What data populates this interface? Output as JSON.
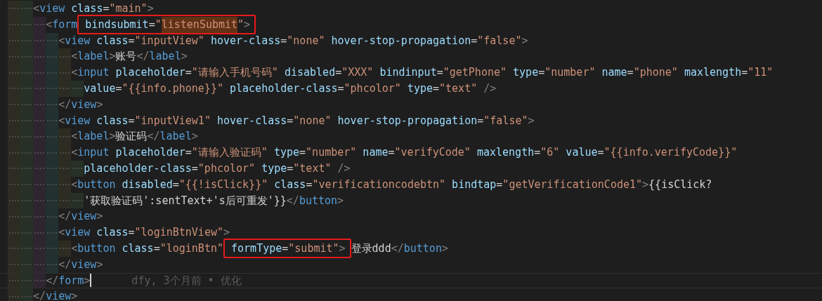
{
  "editor": {
    "lines": [
      {
        "current": false,
        "tokens": [
          {
            "kind": "punct",
            "text": "<"
          },
          {
            "kind": "tag",
            "text": "view"
          },
          {
            "kind": "attr",
            "text": "class"
          },
          {
            "kind": "eq",
            "text": "="
          },
          {
            "kind": "string",
            "text": "\"main\""
          },
          {
            "kind": "punct",
            "text": ">"
          }
        ],
        "children": [
          {
            "current": false,
            "tokens": [
              {
                "kind": "punct",
                "text": "<"
              },
              {
                "kind": "tag",
                "text": "form"
              },
              {
                "kind": "box",
                "tokens": [
                  {
                    "kind": "attr",
                    "text": "bindsubmit"
                  },
                  {
                    "kind": "eq",
                    "text": "="
                  },
                  {
                    "kind": "string",
                    "text": "\""
                  },
                  {
                    "kind": "match",
                    "text": "listenSubmit"
                  },
                  {
                    "kind": "string",
                    "text": "\""
                  },
                  {
                    "kind": "punct",
                    "text": ">"
                  }
                ]
              }
            ],
            "children": [
              {
                "current": false,
                "tokens": [
                  {
                    "kind": "punct",
                    "text": "<"
                  },
                  {
                    "kind": "tag",
                    "text": "view"
                  },
                  {
                    "kind": "attr",
                    "text": "class"
                  },
                  {
                    "kind": "eq",
                    "text": "="
                  },
                  {
                    "kind": "string",
                    "text": "\"inputView\""
                  },
                  {
                    "kind": "attr",
                    "text": "hover-class"
                  },
                  {
                    "kind": "eq",
                    "text": "="
                  },
                  {
                    "kind": "string",
                    "text": "\"none\""
                  },
                  {
                    "kind": "attr",
                    "text": "hover-stop-propagation"
                  },
                  {
                    "kind": "eq",
                    "text": "="
                  },
                  {
                    "kind": "string",
                    "text": "\"false\""
                  },
                  {
                    "kind": "punct",
                    "text": ">"
                  }
                ],
                "children": [
                  {
                    "current": false,
                    "tokens": [
                      {
                        "kind": "punct",
                        "text": "<"
                      },
                      {
                        "kind": "tag",
                        "text": "label"
                      },
                      {
                        "kind": "punct",
                        "text": ">"
                      },
                      {
                        "kind": "text",
                        "text": "账号"
                      },
                      {
                        "kind": "punct",
                        "text": "</"
                      },
                      {
                        "kind": "tag",
                        "text": "label"
                      },
                      {
                        "kind": "punct",
                        "text": ">"
                      }
                    ]
                  },
                  {
                    "current": false,
                    "tokens": [
                      {
                        "kind": "punct",
                        "text": "<"
                      },
                      {
                        "kind": "tag",
                        "text": "input"
                      },
                      {
                        "kind": "attr",
                        "text": "placeholder"
                      },
                      {
                        "kind": "eq",
                        "text": "="
                      },
                      {
                        "kind": "string",
                        "text": "\"请输入手机号码\""
                      },
                      {
                        "kind": "attr",
                        "text": "disabled"
                      },
                      {
                        "kind": "eq",
                        "text": "="
                      },
                      {
                        "kind": "string",
                        "text": "\"XXX\""
                      },
                      {
                        "kind": "attr",
                        "text": "bindinput"
                      },
                      {
                        "kind": "eq",
                        "text": "="
                      },
                      {
                        "kind": "string",
                        "text": "\"getPhone\""
                      },
                      {
                        "kind": "attr",
                        "text": "type"
                      },
                      {
                        "kind": "eq",
                        "text": "="
                      },
                      {
                        "kind": "string",
                        "text": "\"number\""
                      },
                      {
                        "kind": "attr",
                        "text": "name"
                      },
                      {
                        "kind": "eq",
                        "text": "="
                      },
                      {
                        "kind": "string",
                        "text": "\"phone\""
                      },
                      {
                        "kind": "attr",
                        "text": "maxlength"
                      },
                      {
                        "kind": "eq",
                        "text": "="
                      },
                      {
                        "kind": "string",
                        "text": "\"11\""
                      }
                    ],
                    "continuation": [
                      {
                        "tokens": [
                          {
                            "kind": "attr",
                            "text": "value"
                          },
                          {
                            "kind": "eq",
                            "text": "="
                          },
                          {
                            "kind": "string",
                            "text": "\"{{info.phone}}\""
                          },
                          {
                            "kind": "attr",
                            "text": "placeholder-class"
                          },
                          {
                            "kind": "eq",
                            "text": "="
                          },
                          {
                            "kind": "string",
                            "text": "\"phcolor\""
                          },
                          {
                            "kind": "attr",
                            "text": "type"
                          },
                          {
                            "kind": "eq",
                            "text": "="
                          },
                          {
                            "kind": "string",
                            "text": "\"text\""
                          },
                          {
                            "kind": "selfclose",
                            "text": "/>"
                          }
                        ]
                      }
                    ]
                  }
                ]
              },
              {
                "current": false,
                "tokens": [
                  {
                    "kind": "punct",
                    "text": "</"
                  },
                  {
                    "kind": "tag",
                    "text": "view"
                  },
                  {
                    "kind": "punct",
                    "text": ">"
                  }
                ]
              },
              {
                "current": false,
                "tokens": [
                  {
                    "kind": "punct",
                    "text": "<"
                  },
                  {
                    "kind": "tag",
                    "text": "view"
                  },
                  {
                    "kind": "attr",
                    "text": "class"
                  },
                  {
                    "kind": "eq",
                    "text": "="
                  },
                  {
                    "kind": "string",
                    "text": "\"inputView1\""
                  },
                  {
                    "kind": "attr",
                    "text": "hover-class"
                  },
                  {
                    "kind": "eq",
                    "text": "="
                  },
                  {
                    "kind": "string",
                    "text": "\"none\""
                  },
                  {
                    "kind": "attr",
                    "text": "hover-stop-propagation"
                  },
                  {
                    "kind": "eq",
                    "text": "="
                  },
                  {
                    "kind": "string",
                    "text": "\"false\""
                  },
                  {
                    "kind": "punct",
                    "text": ">"
                  }
                ],
                "children": [
                  {
                    "current": false,
                    "tokens": [
                      {
                        "kind": "punct",
                        "text": "<"
                      },
                      {
                        "kind": "tag",
                        "text": "label"
                      },
                      {
                        "kind": "punct",
                        "text": ">"
                      },
                      {
                        "kind": "text",
                        "text": "验证码"
                      },
                      {
                        "kind": "punct",
                        "text": "</"
                      },
                      {
                        "kind": "tag",
                        "text": "label"
                      },
                      {
                        "kind": "punct",
                        "text": ">"
                      }
                    ]
                  },
                  {
                    "current": false,
                    "tokens": [
                      {
                        "kind": "punct",
                        "text": "<"
                      },
                      {
                        "kind": "tag",
                        "text": "input"
                      },
                      {
                        "kind": "attr",
                        "text": "placeholder"
                      },
                      {
                        "kind": "eq",
                        "text": "="
                      },
                      {
                        "kind": "string",
                        "text": "\"请输入验证码\""
                      },
                      {
                        "kind": "attr",
                        "text": "type"
                      },
                      {
                        "kind": "eq",
                        "text": "="
                      },
                      {
                        "kind": "string",
                        "text": "\"number\""
                      },
                      {
                        "kind": "attr",
                        "text": "name"
                      },
                      {
                        "kind": "eq",
                        "text": "="
                      },
                      {
                        "kind": "string",
                        "text": "\"verifyCode\""
                      },
                      {
                        "kind": "attr",
                        "text": "maxlength"
                      },
                      {
                        "kind": "eq",
                        "text": "="
                      },
                      {
                        "kind": "string",
                        "text": "\"6\""
                      },
                      {
                        "kind": "attr",
                        "text": "value"
                      },
                      {
                        "kind": "eq",
                        "text": "="
                      },
                      {
                        "kind": "string",
                        "text": "\"{{info.verifyCode}}\""
                      }
                    ],
                    "continuation": [
                      {
                        "tokens": [
                          {
                            "kind": "attr",
                            "text": "placeholder-class"
                          },
                          {
                            "kind": "eq",
                            "text": "="
                          },
                          {
                            "kind": "string",
                            "text": "\"phcolor\""
                          },
                          {
                            "kind": "attr",
                            "text": "type"
                          },
                          {
                            "kind": "eq",
                            "text": "="
                          },
                          {
                            "kind": "string",
                            "text": "\"text\""
                          },
                          {
                            "kind": "selfclose",
                            "text": "/>"
                          }
                        ]
                      }
                    ]
                  },
                  {
                    "current": false,
                    "tokens": [
                      {
                        "kind": "punct",
                        "text": "<"
                      },
                      {
                        "kind": "tag",
                        "text": "button"
                      },
                      {
                        "kind": "attr",
                        "text": "disabled"
                      },
                      {
                        "kind": "eq",
                        "text": "="
                      },
                      {
                        "kind": "string",
                        "text": "\"{{!isClick}}\""
                      },
                      {
                        "kind": "attr",
                        "text": "class"
                      },
                      {
                        "kind": "eq",
                        "text": "="
                      },
                      {
                        "kind": "string",
                        "text": "\"verificationcodebtn\""
                      },
                      {
                        "kind": "attr",
                        "text": "bindtap"
                      },
                      {
                        "kind": "eq",
                        "text": "="
                      },
                      {
                        "kind": "string",
                        "text": "\"getVerificationCode1\""
                      },
                      {
                        "kind": "punct",
                        "text": ">"
                      },
                      {
                        "kind": "text",
                        "text": "{{isClick?"
                      }
                    ],
                    "continuation": [
                      {
                        "tokens": [
                          {
                            "kind": "text",
                            "text": "'获取验证码':sentText+'s后可重发'}}"
                          },
                          {
                            "kind": "punct",
                            "text": "</"
                          },
                          {
                            "kind": "tag",
                            "text": "button"
                          },
                          {
                            "kind": "punct",
                            "text": ">"
                          }
                        ]
                      }
                    ]
                  }
                ]
              },
              {
                "current": false,
                "tokens": [
                  {
                    "kind": "punct",
                    "text": "</"
                  },
                  {
                    "kind": "tag",
                    "text": "view"
                  },
                  {
                    "kind": "punct",
                    "text": ">"
                  }
                ]
              },
              {
                "current": false,
                "tokens": [
                  {
                    "kind": "punct",
                    "text": "<"
                  },
                  {
                    "kind": "tag",
                    "text": "view"
                  },
                  {
                    "kind": "attr",
                    "text": "class"
                  },
                  {
                    "kind": "eq",
                    "text": "="
                  },
                  {
                    "kind": "string",
                    "text": "\"loginBtnView\""
                  },
                  {
                    "kind": "punct",
                    "text": ">"
                  }
                ],
                "children": [
                  {
                    "current": false,
                    "tokens": [
                      {
                        "kind": "punct",
                        "text": "<"
                      },
                      {
                        "kind": "tag",
                        "text": "button"
                      },
                      {
                        "kind": "attr",
                        "text": "class"
                      },
                      {
                        "kind": "eq",
                        "text": "="
                      },
                      {
                        "kind": "string",
                        "text": "\"loginBtn\""
                      },
                      {
                        "kind": "box",
                        "tokens": [
                          {
                            "kind": "attr",
                            "text": "formType"
                          },
                          {
                            "kind": "eq",
                            "text": "="
                          },
                          {
                            "kind": "string",
                            "text": "\"submit\""
                          },
                          {
                            "kind": "punct",
                            "text": ">"
                          }
                        ]
                      },
                      {
                        "kind": "text",
                        "text": "登录ddd"
                      },
                      {
                        "kind": "punct",
                        "text": "</"
                      },
                      {
                        "kind": "tag",
                        "text": "button"
                      },
                      {
                        "kind": "punct",
                        "text": ">"
                      }
                    ]
                  }
                ]
              },
              {
                "current": false,
                "tokens": [
                  {
                    "kind": "punct",
                    "text": "</"
                  },
                  {
                    "kind": "tag",
                    "text": "view"
                  },
                  {
                    "kind": "punct",
                    "text": ">"
                  }
                ]
              }
            ]
          },
          {
            "current": true,
            "blame": "dfy, 3个月前 • 优化",
            "tokens": [
              {
                "kind": "punct",
                "text": "</"
              },
              {
                "kind": "tag",
                "text": "form"
              },
              {
                "kind": "punct",
                "text": ">"
              }
            ]
          }
        ]
      },
      {
        "current": false,
        "tokens": [
          {
            "kind": "punct",
            "text": "</"
          },
          {
            "kind": "tag",
            "text": "view"
          },
          {
            "kind": "punct",
            "text": ">"
          }
        ]
      }
    ]
  }
}
